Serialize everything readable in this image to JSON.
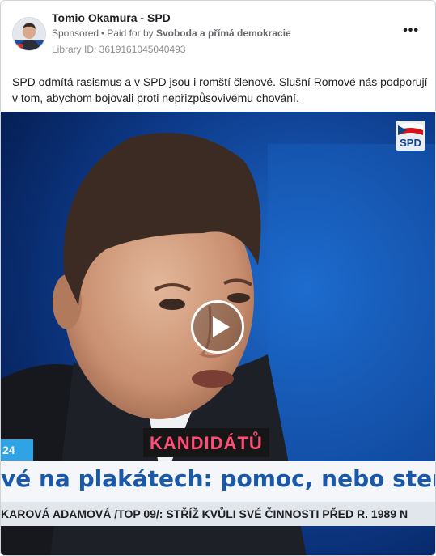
{
  "post": {
    "page_name": "Tomio Okamura - SPD",
    "sponsored_label": "Sponsored",
    "separator": "•",
    "paid_for_label": "Paid for by",
    "payer": "Svoboda a přímá demokracie",
    "library_id": "Library ID: 3619161045040493",
    "more_label": "•••",
    "text": "SPD odmítá rasismus a v SPD jsou i romští členové. Slušní Romové nás podporují v tom, abychom bojovali proti nepřizpůsovivému chování."
  },
  "video": {
    "logo_text": "SPD",
    "overlay_label": "KANDIDÁTŮ",
    "channel_tag": "24",
    "headline": "vé na plakátech: pomoc, nebo stereot",
    "ticker": "KAROVÁ ADAMOVÁ /TOP 09/: STŘÍŽ KVŮLI SVÉ ČINNOSTI PŘED R. 1989 N",
    "play_icon": "play-icon"
  },
  "colors": {
    "background_blue": "#0b2f73",
    "headline_text": "#1a59a8",
    "overlay_text": "#ff4d78",
    "channel_tag": "#2ea3e6"
  }
}
